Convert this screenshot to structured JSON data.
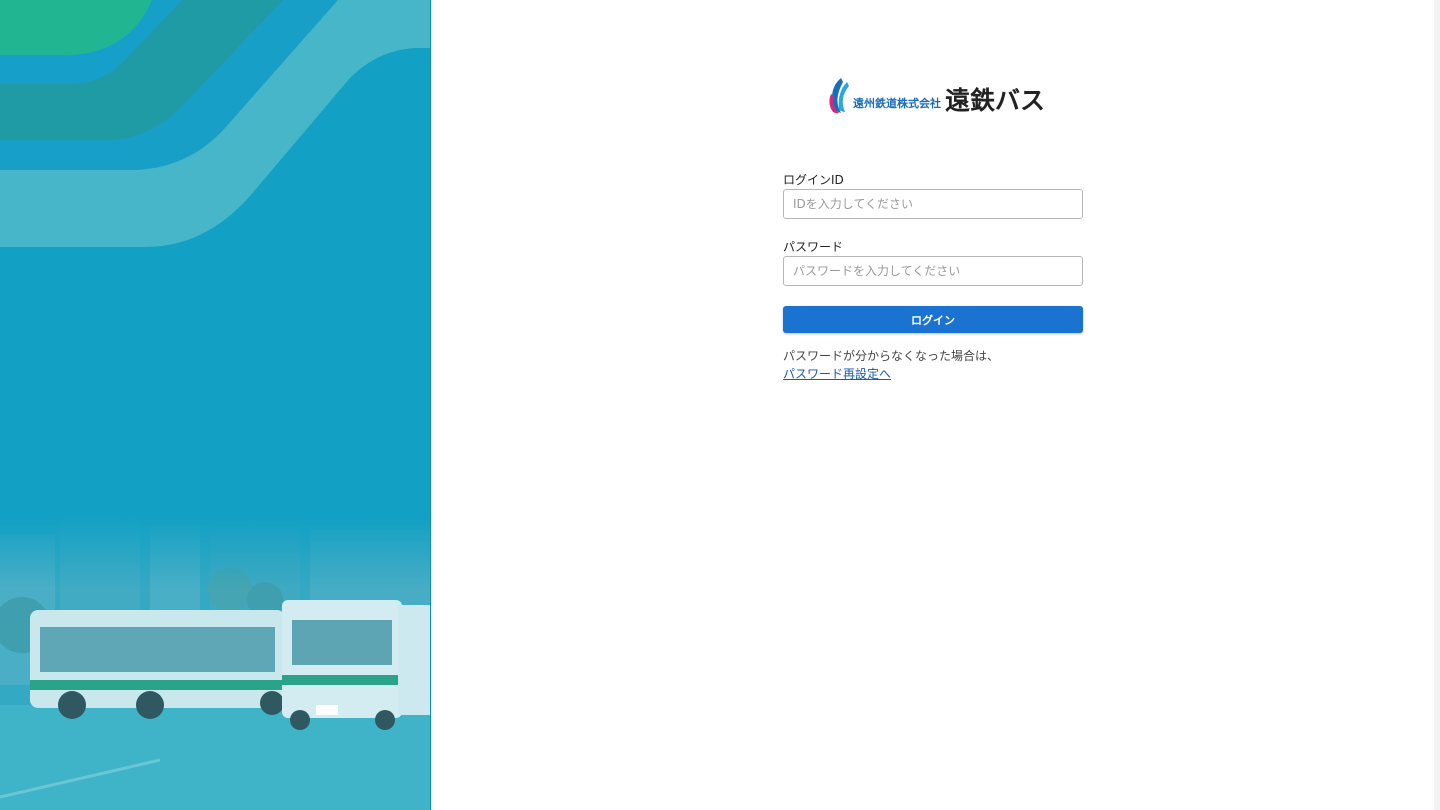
{
  "logo": {
    "company": "遠州鉄道株式会社",
    "brand": "遠鉄バス"
  },
  "form": {
    "login_id": {
      "label": "ログインID",
      "placeholder": "IDを入力してください"
    },
    "password": {
      "label": "パスワード",
      "placeholder": "パスワードを入力してください"
    },
    "submit_label": "ログイン"
  },
  "help": {
    "text": "パスワードが分からなくなった場合は、",
    "link": "パスワード再設定へ"
  },
  "colors": {
    "panel": "#12a0c4",
    "accent": "#1a73d0",
    "link": "#1a5bb0",
    "logo_blue": "#1c6db8",
    "logo_magenta": "#d6287e"
  }
}
